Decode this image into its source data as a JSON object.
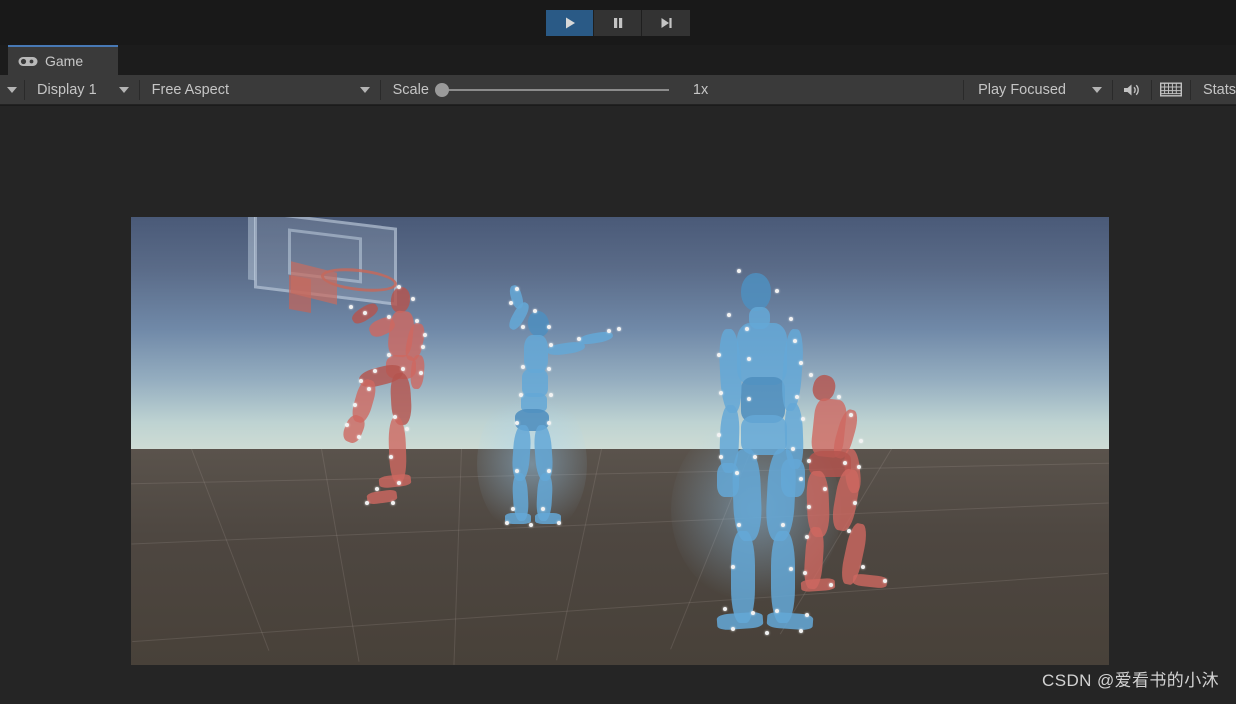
{
  "playbar": {
    "buttons": [
      {
        "name": "play-button",
        "icon": "play-icon",
        "label": "Play",
        "active": true
      },
      {
        "name": "pause-button",
        "icon": "pause-icon",
        "label": "Pause",
        "active": false
      },
      {
        "name": "step-button",
        "icon": "step-icon",
        "label": "Step",
        "active": false
      }
    ],
    "active_color": "#2a5a86"
  },
  "tabs": [
    {
      "label": "Game",
      "icon": "gamepad-icon",
      "active": true,
      "accent": "#4879b5"
    }
  ],
  "toolbar": {
    "menu_caret": "chevron-down-icon",
    "display": {
      "label": "Display 1",
      "caret": "chevron-down-icon"
    },
    "aspect": {
      "label": "Free Aspect",
      "caret": "chevron-down-icon"
    },
    "scale": {
      "label": "Scale",
      "value": "1x",
      "slider_position": 0
    },
    "focus": {
      "label": "Play Focused",
      "caret": "chevron-down-icon"
    },
    "mute": {
      "icon": "speaker-icon",
      "label": "Mute Audio"
    },
    "stats_icon": {
      "icon": "keyboard-grid-icon"
    },
    "stats": {
      "label": "Stats"
    }
  },
  "gameview": {
    "background": "#252525",
    "scene": {
      "description": "Basketball motion-capture scene",
      "sky_top": "#4a5a78",
      "sky_horizon": "#cfdcd4",
      "ground": "#4e4741",
      "objects": [
        {
          "name": "basketball-backboard",
          "color": "#c4d2e2"
        },
        {
          "name": "basketball-hoop",
          "color": "#c4685c"
        },
        {
          "name": "mocap-figure-red-dunking",
          "color": "#ce6860"
        },
        {
          "name": "mocap-figure-blue-arms-out",
          "color": "#64a8d6"
        },
        {
          "name": "mocap-figure-blue-standing",
          "color": "#64a8d6"
        },
        {
          "name": "mocap-figure-red-crouching",
          "color": "#ce6860"
        }
      ]
    }
  },
  "watermark": {
    "text": "CSDN @爱看书的小沐"
  }
}
